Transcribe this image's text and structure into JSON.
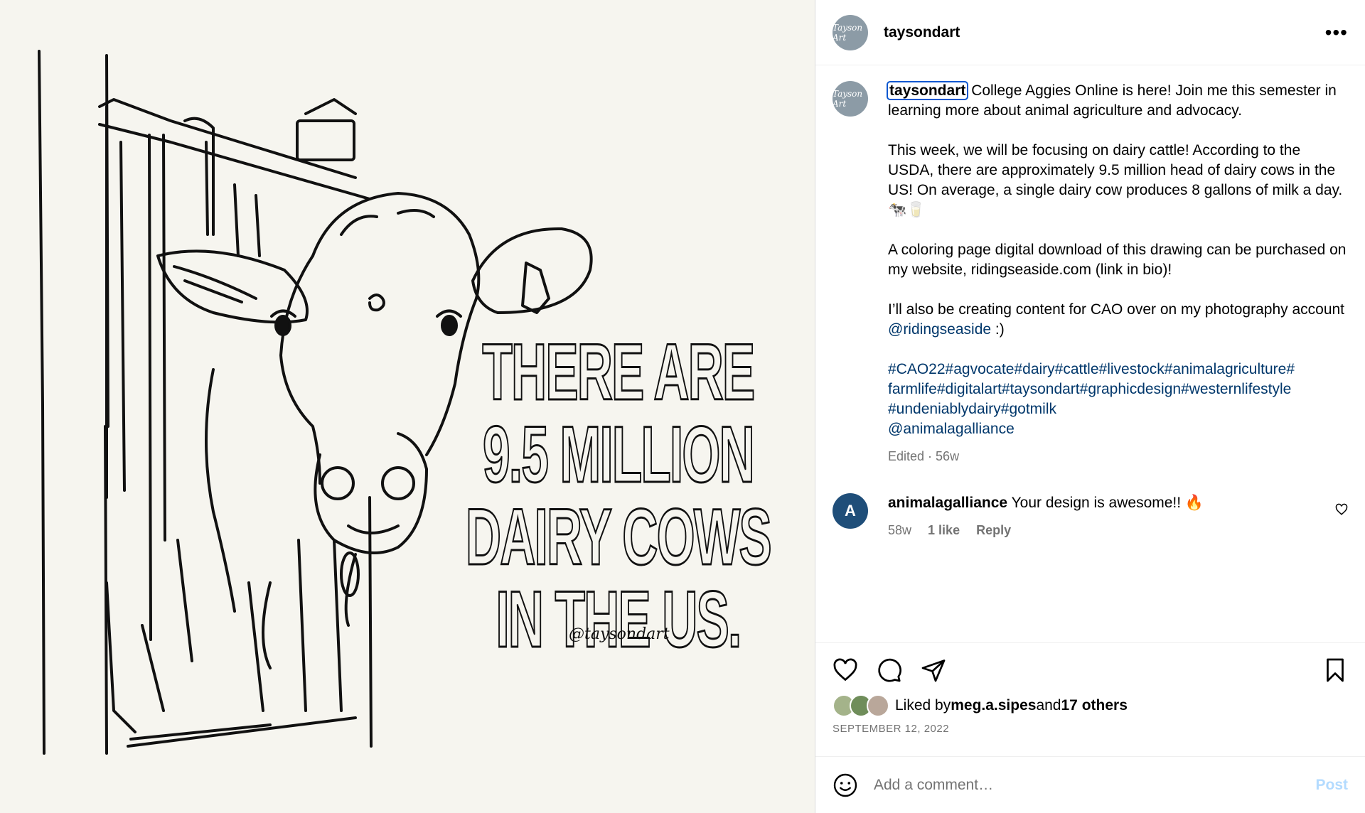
{
  "post": {
    "username": "taysondart",
    "avatar_text": "Tayson Art",
    "more_glyph": "•••"
  },
  "artwork": {
    "lines": [
      "THERE ARE",
      "9.5 MILLION",
      "DAIRY COWS",
      "IN THE US."
    ],
    "signature": "@taysondart"
  },
  "caption": {
    "username": "taysondart",
    "p1": "College Aggies Online is here! Join me this semester in learning more about animal agriculture and advocacy.",
    "p2": "This week, we will be focusing on dairy cattle! According to the USDA, there are approximately 9.5 million head of dairy cows in the US! On average, a single dairy cow produces 8 gallons of milk a day. 🐄🥛",
    "p3": "A coloring page digital download of this drawing can be purchased on my website, ridingseaside.com (link in bio)!",
    "p4_pre": "I’ll also be creating content for CAO over on my photography account ",
    "p4_mention": "@ridingseaside",
    "p4_post": " :)",
    "tags_line1": "#CAO22#agvocate#dairy#cattle#livestock#animalagriculture#",
    "tags_line2": "farmlife#digitalart#taysondart#graphicdesign#westernlifestyle",
    "tags_line3": "#undeniablydairy#gotmilk",
    "mention_line": "@animalagalliance",
    "edited": "Edited",
    "sep": " · ",
    "age": "56w"
  },
  "comment": {
    "username": "animalagalliance",
    "avatar_text": "A",
    "text": "Your design is awesome!! 🔥",
    "age": "58w",
    "likes": "1 like",
    "reply": "Reply"
  },
  "likes": {
    "prefix": "Liked by ",
    "user": "meg.a.sipes",
    "mid": " and ",
    "others": "17 others",
    "date": "SEPTEMBER 12, 2022"
  },
  "composer": {
    "placeholder": "Add a comment…",
    "post_label": "Post"
  },
  "colors": {
    "link": "#00376b",
    "post_disabled": "#b3dbff",
    "muted": "#737373"
  }
}
